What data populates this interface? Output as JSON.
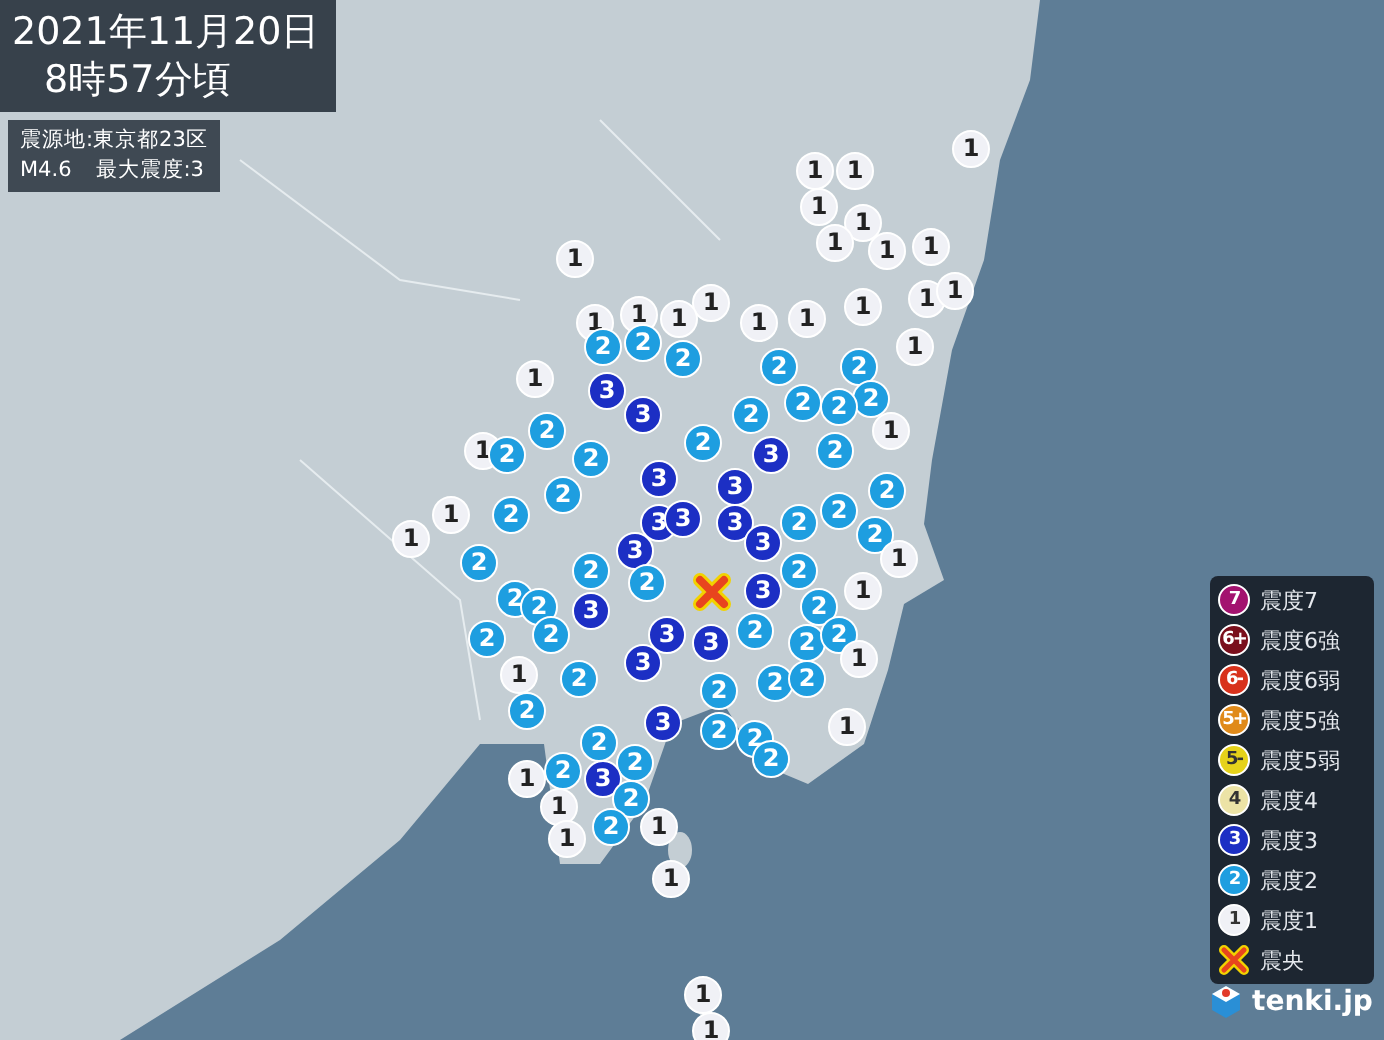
{
  "title": {
    "date": "2021年11月20日",
    "time": "8時57分頃"
  },
  "info": {
    "epicenter": "震源地:東京都23区",
    "magnitude": "M4.6",
    "max_intensity": "最大震度:3"
  },
  "legend": [
    {
      "kind": "scale",
      "symbol": "7",
      "label": "震度7",
      "color": "#a3136f"
    },
    {
      "kind": "scale",
      "symbol": "6+",
      "label": "震度6強",
      "color": "#7a0f1c"
    },
    {
      "kind": "scale",
      "symbol": "6-",
      "label": "震度6弱",
      "color": "#d8321c"
    },
    {
      "kind": "scale",
      "symbol": "5+",
      "label": "震度5強",
      "color": "#e08a1a"
    },
    {
      "kind": "scale",
      "symbol": "5-",
      "label": "震度5弱",
      "color": "#e6d21a"
    },
    {
      "kind": "scale",
      "symbol": "4",
      "label": "震度4",
      "color": "#ece3a6"
    },
    {
      "kind": "scale",
      "symbol": "3",
      "label": "震度3",
      "color": "#1c2fc4"
    },
    {
      "kind": "scale",
      "symbol": "2",
      "label": "震度2",
      "color": "#1e9ee0"
    },
    {
      "kind": "scale",
      "symbol": "1",
      "label": "震度1",
      "color": "#f0f1f6"
    },
    {
      "kind": "epicenter",
      "label": "震央"
    }
  ],
  "brand": "tenki.jp",
  "markers": [
    {
      "text": "1",
      "color": "#f0f1f6"
    },
    {
      "text": "1",
      "color": "#f0f1f6"
    },
    {
      "text": "1",
      "color": "#f0f1f6"
    },
    {
      "text": "1",
      "color": "#f0f1f6"
    },
    {
      "text": "1",
      "color": "#f0f1f6"
    },
    {
      "text": "1",
      "color": "#f0f1f6"
    },
    {
      "text": "1",
      "color": "#f0f1f6"
    },
    {
      "text": "1",
      "color": "#f0f1f6"
    },
    {
      "text": "1",
      "color": "#f0f1f6"
    },
    {
      "text": "1",
      "color": "#f0f1f6"
    },
    {
      "text": "1",
      "color": "#f0f1f6"
    },
    {
      "text": "1",
      "color": "#f0f1f6"
    },
    {
      "text": "1",
      "color": "#f0f1f6"
    },
    {
      "text": "1",
      "color": "#f0f1f6"
    },
    {
      "text": "1",
      "color": "#f0f1f6"
    },
    {
      "text": "1",
      "color": "#f0f1f6"
    },
    {
      "text": "1",
      "color": "#f0f1f6"
    },
    {
      "text": "1",
      "color": "#f0f1f6"
    },
    {
      "text": "2",
      "color": "#1e9ee0"
    },
    {
      "text": "2",
      "color": "#1e9ee0"
    },
    {
      "text": "1",
      "color": "#f0f1f6"
    },
    {
      "text": "1",
      "color": "#f0f1f6"
    },
    {
      "text": "2",
      "color": "#1e9ee0"
    },
    {
      "text": "2",
      "color": "#1e9ee0"
    },
    {
      "text": "2",
      "color": "#1e9ee0"
    },
    {
      "text": "3",
      "color": "#1c2fc4"
    },
    {
      "text": "2",
      "color": "#1e9ee0"
    },
    {
      "text": "2",
      "color": "#1e9ee0"
    },
    {
      "text": "3",
      "color": "#1c2fc4"
    },
    {
      "text": "2",
      "color": "#1e9ee0"
    },
    {
      "text": "2",
      "color": "#1e9ee0"
    },
    {
      "text": "1",
      "color": "#f0f1f6"
    },
    {
      "text": "2",
      "color": "#1e9ee0"
    },
    {
      "text": "2",
      "color": "#1e9ee0"
    },
    {
      "text": "2",
      "color": "#1e9ee0"
    },
    {
      "text": "1",
      "color": "#f0f1f6"
    },
    {
      "text": "2",
      "color": "#1e9ee0"
    },
    {
      "text": "2",
      "color": "#1e9ee0"
    },
    {
      "text": "3",
      "color": "#1c2fc4"
    },
    {
      "text": "2",
      "color": "#1e9ee0"
    },
    {
      "text": "3",
      "color": "#1c2fc4"
    },
    {
      "text": "3",
      "color": "#1c2fc4"
    },
    {
      "text": "2",
      "color": "#1e9ee0"
    },
    {
      "text": "1",
      "color": "#f0f1f6"
    },
    {
      "text": "2",
      "color": "#1e9ee0"
    },
    {
      "text": "3",
      "color": "#1c2fc4"
    },
    {
      "text": "3",
      "color": "#1c2fc4"
    },
    {
      "text": "3",
      "color": "#1c2fc4"
    },
    {
      "text": "2",
      "color": "#1e9ee0"
    },
    {
      "text": "2",
      "color": "#1e9ee0"
    },
    {
      "text": "1",
      "color": "#f0f1f6"
    },
    {
      "text": "2",
      "color": "#1e9ee0"
    },
    {
      "text": "2",
      "color": "#1e9ee0"
    },
    {
      "text": "2",
      "color": "#1e9ee0"
    },
    {
      "text": "3",
      "color": "#1c2fc4"
    },
    {
      "text": "3",
      "color": "#1c2fc4"
    },
    {
      "text": "2",
      "color": "#1e9ee0"
    },
    {
      "text": "1",
      "color": "#f0f1f6"
    },
    {
      "text": "2",
      "color": "#1e9ee0"
    },
    {
      "text": "3",
      "color": "#1c2fc4"
    },
    {
      "text": "1",
      "color": "#f0f1f6"
    },
    {
      "text": "2",
      "color": "#1e9ee0"
    },
    {
      "text": "2",
      "color": "#1e9ee0"
    },
    {
      "text": "3",
      "color": "#1c2fc4"
    },
    {
      "text": "2",
      "color": "#1e9ee0"
    },
    {
      "text": "2",
      "color": "#1e9ee0"
    },
    {
      "text": "2",
      "color": "#1e9ee0"
    },
    {
      "text": "3",
      "color": "#1c2fc4"
    },
    {
      "text": "3",
      "color": "#1c2fc4"
    },
    {
      "text": "2",
      "color": "#1e9ee0"
    },
    {
      "text": "2",
      "color": "#1e9ee0"
    },
    {
      "text": "2",
      "color": "#1e9ee0"
    },
    {
      "text": "3",
      "color": "#1c2fc4"
    },
    {
      "text": "1",
      "color": "#f0f1f6"
    },
    {
      "text": "1",
      "color": "#f0f1f6"
    },
    {
      "text": "2",
      "color": "#1e9ee0"
    },
    {
      "text": "2",
      "color": "#1e9ee0"
    },
    {
      "text": "2",
      "color": "#1e9ee0"
    },
    {
      "text": "2",
      "color": "#1e9ee0"
    },
    {
      "text": "2",
      "color": "#1e9ee0"
    },
    {
      "text": "3",
      "color": "#1c2fc4"
    },
    {
      "text": "2",
      "color": "#1e9ee0"
    },
    {
      "text": "2",
      "color": "#1e9ee0"
    },
    {
      "text": "1",
      "color": "#f0f1f6"
    },
    {
      "text": "2",
      "color": "#1e9ee0"
    },
    {
      "text": "2",
      "color": "#1e9ee0"
    },
    {
      "text": "2",
      "color": "#1e9ee0"
    },
    {
      "text": "1",
      "color": "#f0f1f6"
    },
    {
      "text": "2",
      "color": "#1e9ee0"
    },
    {
      "text": "3",
      "color": "#1c2fc4"
    },
    {
      "text": "1",
      "color": "#f0f1f6"
    },
    {
      "text": "2",
      "color": "#1e9ee0"
    },
    {
      "text": "2",
      "color": "#1e9ee0"
    },
    {
      "text": "1",
      "color": "#f0f1f6"
    },
    {
      "text": "1",
      "color": "#f0f1f6"
    },
    {
      "text": "1",
      "color": "#f0f1f6"
    },
    {
      "text": "1",
      "color": "#f0f1f6"
    },
    {
      "text": "1",
      "color": "#f0f1f6"
    }
  ]
}
